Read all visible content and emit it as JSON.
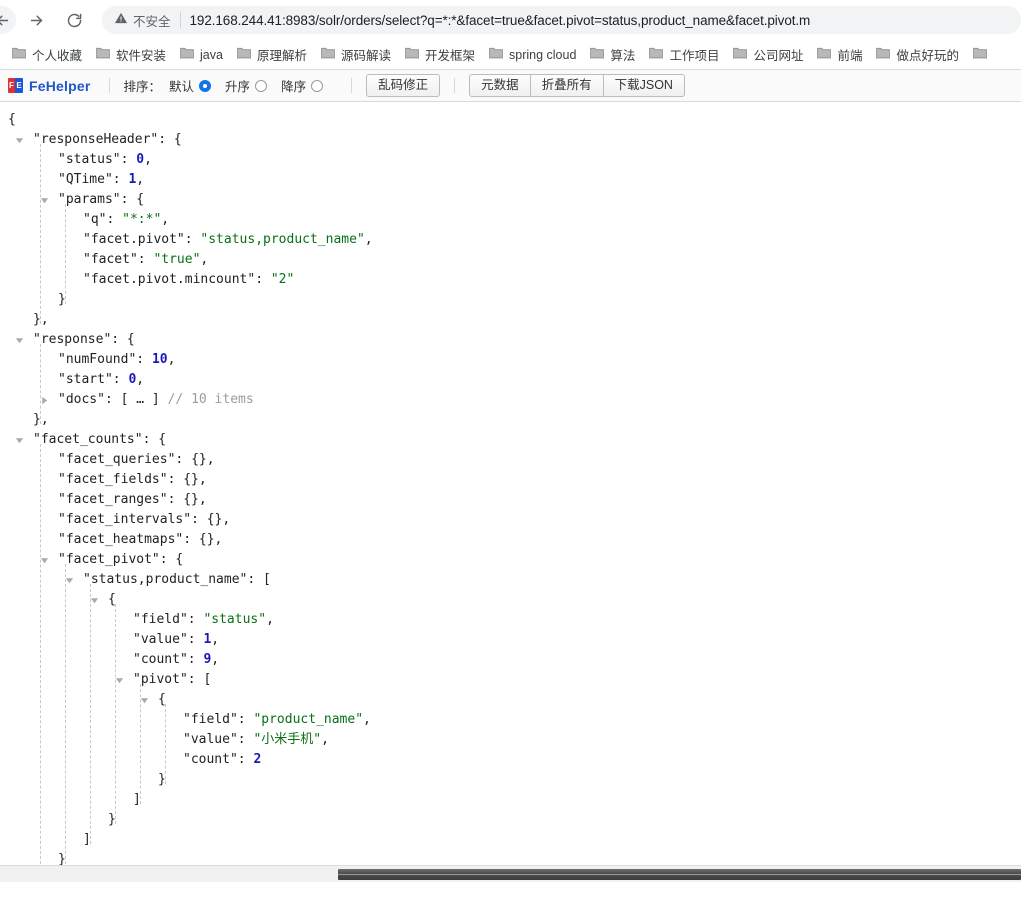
{
  "browser": {
    "back_icon": "arrow-left-icon",
    "forward_icon": "arrow-right-icon",
    "reload_icon": "reload-icon",
    "security_icon": "warning-triangle-icon",
    "security_label": "不安全",
    "url": "192.168.244.41:8983/solr/orders/select?q=*:*&facet=true&facet.pivot=status,product_name&facet.pivot.m"
  },
  "bookmarks": [
    {
      "label": "个人收藏",
      "icon": "folder-icon"
    },
    {
      "label": "软件安装",
      "icon": "folder-icon"
    },
    {
      "label": "java",
      "icon": "folder-icon"
    },
    {
      "label": "原理解析",
      "icon": "folder-icon"
    },
    {
      "label": "源码解读",
      "icon": "folder-icon"
    },
    {
      "label": "开发框架",
      "icon": "folder-icon"
    },
    {
      "label": "spring cloud",
      "icon": "folder-icon"
    },
    {
      "label": "算法",
      "icon": "folder-icon"
    },
    {
      "label": "工作项目",
      "icon": "folder-icon"
    },
    {
      "label": "公司网址",
      "icon": "folder-icon"
    },
    {
      "label": "前端",
      "icon": "folder-icon"
    },
    {
      "label": "做点好玩的",
      "icon": "folder-icon"
    },
    {
      "label": "",
      "icon": "folder-icon"
    }
  ],
  "fehelper": {
    "brand": "FeHelper",
    "mark_left": "F",
    "mark_right": "E",
    "sort_label": "排序：",
    "sort_options": [
      {
        "label": "默认",
        "selected": true
      },
      {
        "label": "升序",
        "selected": false
      },
      {
        "label": "降序",
        "selected": false
      }
    ],
    "fix_encoding_button": "乱码修正",
    "metadata_button": "元数据",
    "collapse_all_button": "折叠所有",
    "download_json_button": "下载JSON"
  },
  "json": {
    "rows": [
      {
        "indent": 0,
        "tri": "",
        "text": "{"
      },
      {
        "indent": 1,
        "tri": "open",
        "text": "\"responseHeader\": {",
        "key": "\"responseHeader\"",
        "punct": ": {"
      },
      {
        "indent": 2,
        "tri": "",
        "key": "\"status\"",
        "sep": ": ",
        "num": "0",
        "punct": ","
      },
      {
        "indent": 2,
        "tri": "",
        "key": "\"QTime\"",
        "sep": ": ",
        "num": "1",
        "punct": ","
      },
      {
        "indent": 2,
        "tri": "open",
        "key": "\"params\"",
        "punct": ": {"
      },
      {
        "indent": 3,
        "tri": "",
        "key": "\"q\"",
        "sep": ": ",
        "str": "\"*:*\"",
        "punct": ","
      },
      {
        "indent": 3,
        "tri": "",
        "key": "\"facet.pivot\"",
        "sep": ": ",
        "str": "\"status,product_name\"",
        "punct": ","
      },
      {
        "indent": 3,
        "tri": "",
        "key": "\"facet\"",
        "sep": ": ",
        "str": "\"true\"",
        "punct": ","
      },
      {
        "indent": 3,
        "tri": "",
        "key": "\"facet.pivot.mincount\"",
        "sep": ": ",
        "str": "\"2\"",
        "punct": ""
      },
      {
        "indent": 2,
        "tri": "",
        "text": "}"
      },
      {
        "indent": 1,
        "tri": "",
        "text": "},"
      },
      {
        "indent": 1,
        "tri": "open",
        "key": "\"response\"",
        "punct": ": {"
      },
      {
        "indent": 2,
        "tri": "",
        "key": "\"numFound\"",
        "sep": ": ",
        "num": "10",
        "punct": ","
      },
      {
        "indent": 2,
        "tri": "",
        "key": "\"start\"",
        "sep": ": ",
        "num": "0",
        "punct": ","
      },
      {
        "indent": 2,
        "tri": "closed",
        "key": "\"docs\"",
        "sep": ": ",
        "punct": "[ … ]",
        "comment": "// 10 items"
      },
      {
        "indent": 1,
        "tri": "",
        "text": "},"
      },
      {
        "indent": 1,
        "tri": "open",
        "key": "\"facet_counts\"",
        "punct": ": {"
      },
      {
        "indent": 2,
        "tri": "",
        "key": "\"facet_queries\"",
        "sep": ": ",
        "punct": "{},"
      },
      {
        "indent": 2,
        "tri": "",
        "key": "\"facet_fields\"",
        "sep": ": ",
        "punct": "{},"
      },
      {
        "indent": 2,
        "tri": "",
        "key": "\"facet_ranges\"",
        "sep": ": ",
        "punct": "{},"
      },
      {
        "indent": 2,
        "tri": "",
        "key": "\"facet_intervals\"",
        "sep": ": ",
        "punct": "{},"
      },
      {
        "indent": 2,
        "tri": "",
        "key": "\"facet_heatmaps\"",
        "sep": ": ",
        "punct": "{},"
      },
      {
        "indent": 2,
        "tri": "open",
        "key": "\"facet_pivot\"",
        "punct": ": {"
      },
      {
        "indent": 3,
        "tri": "open",
        "key": "\"status,product_name\"",
        "punct": ": ["
      },
      {
        "indent": 4,
        "tri": "open",
        "text": "{"
      },
      {
        "indent": 5,
        "tri": "",
        "key": "\"field\"",
        "sep": ": ",
        "str": "\"status\"",
        "punct": ","
      },
      {
        "indent": 5,
        "tri": "",
        "key": "\"value\"",
        "sep": ": ",
        "num": "1",
        "punct": ","
      },
      {
        "indent": 5,
        "tri": "",
        "key": "\"count\"",
        "sep": ": ",
        "num": "9",
        "punct": ","
      },
      {
        "indent": 5,
        "tri": "open",
        "key": "\"pivot\"",
        "punct": ": ["
      },
      {
        "indent": 6,
        "tri": "open",
        "text": "{"
      },
      {
        "indent": 7,
        "tri": "",
        "key": "\"field\"",
        "sep": ": ",
        "str": "\"product_name\"",
        "punct": ","
      },
      {
        "indent": 7,
        "tri": "",
        "key": "\"value\"",
        "sep": ": ",
        "str": "\"小米手机\"",
        "punct": ","
      },
      {
        "indent": 7,
        "tri": "",
        "key": "\"count\"",
        "sep": ": ",
        "num": "2",
        "punct": ""
      },
      {
        "indent": 6,
        "tri": "",
        "text": "}"
      },
      {
        "indent": 5,
        "tri": "",
        "text": "]"
      },
      {
        "indent": 4,
        "tri": "",
        "text": "}"
      },
      {
        "indent": 3,
        "tri": "",
        "text": "]"
      },
      {
        "indent": 2,
        "tri": "",
        "text": "}"
      },
      {
        "indent": 1,
        "tri": "",
        "text": "}"
      },
      {
        "indent": 0,
        "tri": "",
        "text": "}"
      }
    ]
  },
  "scrollbar": {
    "orientation": "horizontal"
  },
  "colors": {
    "string": "#097014",
    "number": "#1a1ab3",
    "key": "#222222",
    "comment": "#9b9b9b",
    "brand": "#2156c7"
  }
}
